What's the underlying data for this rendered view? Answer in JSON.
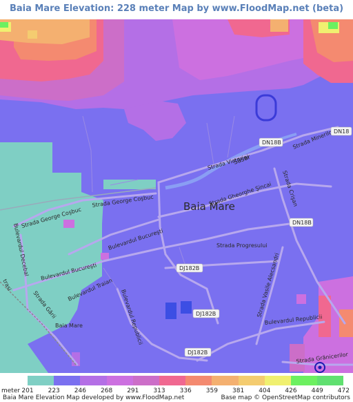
{
  "title": "Baia Mare Elevation: 228 meter Map by www.FloodMap.net (beta)",
  "legend": {
    "unit": "meter",
    "ticks": [
      "201",
      "223",
      "246",
      "268",
      "291",
      "313",
      "336",
      "359",
      "381",
      "404",
      "426",
      "449",
      "472"
    ],
    "colors": [
      "#7fcfc4",
      "#7a70f0",
      "#b46fe6",
      "#cc70e0",
      "#cc6ec8",
      "#f06890",
      "#f48a70",
      "#f4b070",
      "#f4cc70",
      "#f0f070",
      "#6cf060",
      "#60e070"
    ]
  },
  "footer": {
    "left": "Baia Mare Elevation Map developed by www.FloodMap.net",
    "right": "Base map © OpenStreetMap contributors"
  },
  "map": {
    "city_label": "Baia Mare",
    "city_label_small": "Baia Mare",
    "river_label": "Săsar",
    "streets": {
      "victoriei": "Strada Victoriei",
      "minerilor": "Strada Minerilor",
      "gheorghe_sincai": "Strada Gheorghe Şincai",
      "crisan": "Strada Crişan",
      "george_cosbuc_1": "Strada George Coşbuc",
      "george_cosbuc_2": "Strada George Coşbuc",
      "bulevardul_bucuresti_1": "Bulevardul Bucureşti",
      "bulevardul_bucuresti_2": "Bulevardul Bucureşti",
      "bulevardul_decebal": "Bulevardul Decebal",
      "progresului": "Strada Progresului",
      "bulevardul_traian": "Bulevardul Traian",
      "bulevardul_republicii_1": "Bulevardul Republicii",
      "bulevardul_republicii_2": "Bulevardul Republicii",
      "vasile_alecsandri": "Strada Vasile Alecsandri",
      "garii": "Strada Gării",
      "granicerilor": "Strada Grănicerilor",
      "edge_left": "trasi"
    },
    "road_badges": {
      "dn18": "DN18",
      "dn18b_1": "DN18B",
      "dn18b_2": "DN18B",
      "dj182b_1": "DJ182B",
      "dj182b_2": "DJ182B",
      "dj182b_3": "DJ182B"
    }
  }
}
